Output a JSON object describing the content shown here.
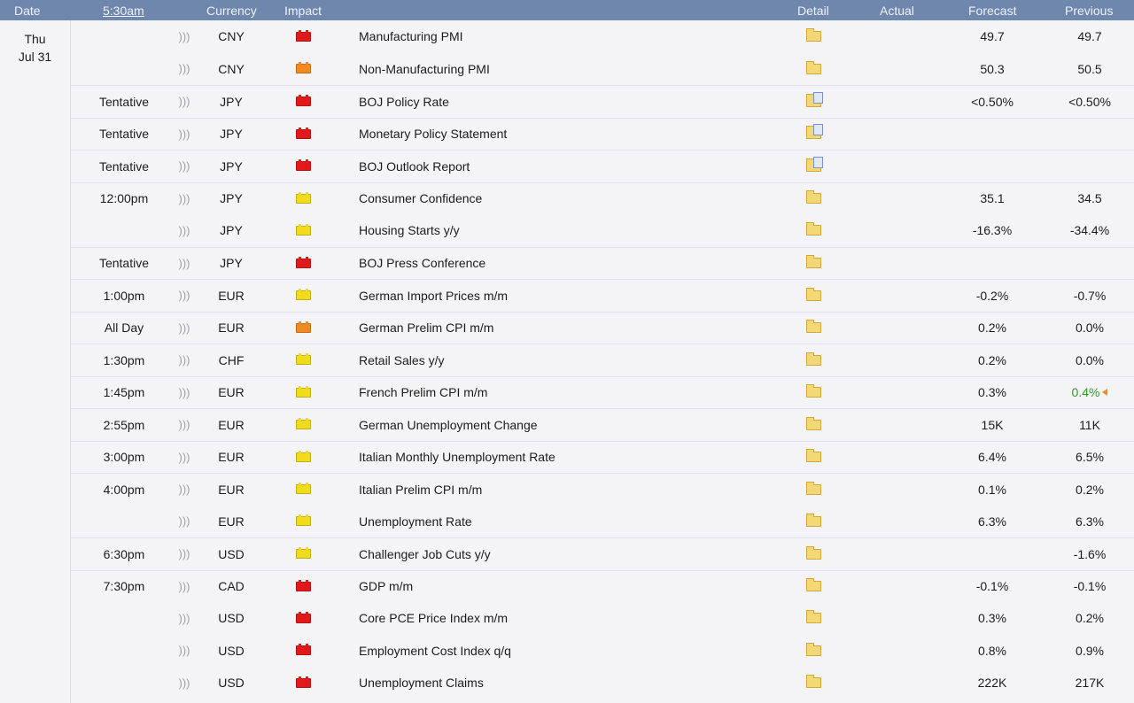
{
  "header": {
    "date": "Date",
    "time": "5:30am",
    "currency": "Currency",
    "impact": "Impact",
    "detail": "Detail",
    "actual": "Actual",
    "forecast": "Forecast",
    "previous": "Previous"
  },
  "day": {
    "weekday": "Thu",
    "date": "Jul 31"
  },
  "colors": {
    "header_bg": "#6f86ad",
    "high": "#e31818",
    "medium": "#f08a1f",
    "low": "#f1dc1b",
    "better": "#2f9b26"
  },
  "events": [
    {
      "time": "",
      "currency": "CNY",
      "impact": "red",
      "event": "Manufacturing PMI",
      "detail": "folder",
      "forecast": "49.7",
      "previous": "49.7"
    },
    {
      "time": "",
      "currency": "CNY",
      "impact": "orange",
      "event": "Non-Manufacturing PMI",
      "detail": "folder",
      "forecast": "50.3",
      "previous": "50.5"
    },
    {
      "time": "Tentative",
      "currency": "JPY",
      "impact": "red",
      "event": "BOJ Policy Rate",
      "detail": "folder-doc",
      "forecast": "<0.50%",
      "previous": "<0.50%"
    },
    {
      "time": "Tentative",
      "currency": "JPY",
      "impact": "red",
      "event": "Monetary Policy Statement",
      "detail": "folder-doc",
      "forecast": "",
      "previous": ""
    },
    {
      "time": "Tentative",
      "currency": "JPY",
      "impact": "red",
      "event": "BOJ Outlook Report",
      "detail": "folder-doc",
      "forecast": "",
      "previous": ""
    },
    {
      "time": "12:00pm",
      "currency": "JPY",
      "impact": "yellow",
      "event": "Consumer Confidence",
      "detail": "folder",
      "forecast": "35.1",
      "previous": "34.5"
    },
    {
      "time": "",
      "currency": "JPY",
      "impact": "yellow",
      "event": "Housing Starts y/y",
      "detail": "folder",
      "forecast": "-16.3%",
      "previous": "-34.4%"
    },
    {
      "time": "Tentative",
      "currency": "JPY",
      "impact": "red",
      "event": "BOJ Press Conference",
      "detail": "folder",
      "forecast": "",
      "previous": ""
    },
    {
      "time": "1:00pm",
      "currency": "EUR",
      "impact": "yellow",
      "event": "German Import Prices m/m",
      "detail": "folder",
      "forecast": "-0.2%",
      "previous": "-0.7%"
    },
    {
      "time": "All Day",
      "currency": "EUR",
      "impact": "orange",
      "event": "German Prelim CPI m/m",
      "detail": "folder",
      "forecast": "0.2%",
      "previous": "0.0%"
    },
    {
      "time": "1:30pm",
      "currency": "CHF",
      "impact": "yellow",
      "event": "Retail Sales y/y",
      "detail": "folder",
      "forecast": "0.2%",
      "previous": "0.0%"
    },
    {
      "time": "1:45pm",
      "currency": "EUR",
      "impact": "yellow",
      "event": "French Prelim CPI m/m",
      "detail": "folder",
      "forecast": "0.3%",
      "previous": "0.4%",
      "revised": true
    },
    {
      "time": "2:55pm",
      "currency": "EUR",
      "impact": "yellow",
      "event": "German Unemployment Change",
      "detail": "folder",
      "forecast": "15K",
      "previous": "11K"
    },
    {
      "time": "3:00pm",
      "currency": "EUR",
      "impact": "yellow",
      "event": "Italian Monthly Unemployment Rate",
      "detail": "folder",
      "forecast": "6.4%",
      "previous": "6.5%"
    },
    {
      "time": "4:00pm",
      "currency": "EUR",
      "impact": "yellow",
      "event": "Italian Prelim CPI m/m",
      "detail": "folder",
      "forecast": "0.1%",
      "previous": "0.2%"
    },
    {
      "time": "",
      "currency": "EUR",
      "impact": "yellow",
      "event": "Unemployment Rate",
      "detail": "folder",
      "forecast": "6.3%",
      "previous": "6.3%"
    },
    {
      "time": "6:30pm",
      "currency": "USD",
      "impact": "yellow",
      "event": "Challenger Job Cuts y/y",
      "detail": "folder",
      "forecast": "",
      "previous": "-1.6%"
    },
    {
      "time": "7:30pm",
      "currency": "CAD",
      "impact": "red",
      "event": "GDP m/m",
      "detail": "folder",
      "forecast": "-0.1%",
      "previous": "-0.1%"
    },
    {
      "time": "",
      "currency": "USD",
      "impact": "red",
      "event": "Core PCE Price Index m/m",
      "detail": "folder",
      "forecast": "0.3%",
      "previous": "0.2%"
    },
    {
      "time": "",
      "currency": "USD",
      "impact": "red",
      "event": "Employment Cost Index q/q",
      "detail": "folder",
      "forecast": "0.8%",
      "previous": "0.9%"
    },
    {
      "time": "",
      "currency": "USD",
      "impact": "red",
      "event": "Unemployment Claims",
      "detail": "folder",
      "forecast": "222K",
      "previous": "217K"
    }
  ]
}
